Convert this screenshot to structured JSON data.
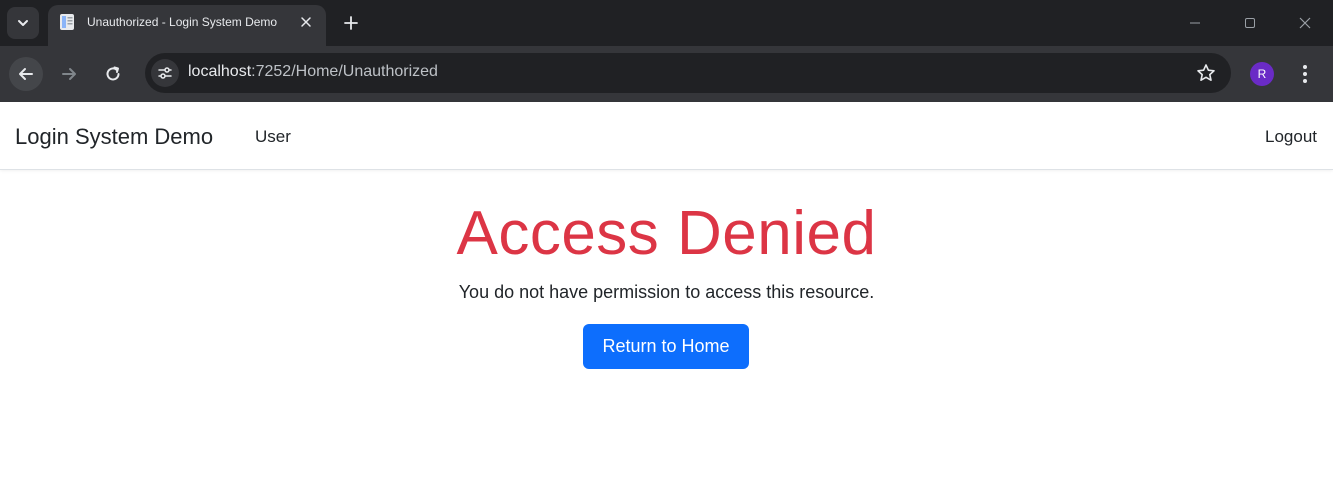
{
  "browser": {
    "tab_title": "Unauthorized - Login System Demo",
    "url_host": "localhost",
    "url_path": ":7252/Home/Unauthorized",
    "profile_initial": "R",
    "colors": {
      "tabstrip": "#202124",
      "toolbar": "#35363a",
      "avatar": "#6a2bc6"
    }
  },
  "navbar": {
    "brand": "Login System Demo",
    "user_link": "User",
    "logout_link": "Logout"
  },
  "main": {
    "heading": "Access Denied",
    "message": "You do not have permission to access this resource.",
    "button_label": "Return to Home",
    "colors": {
      "heading": "#dc3545",
      "button": "#0d6efd"
    }
  }
}
